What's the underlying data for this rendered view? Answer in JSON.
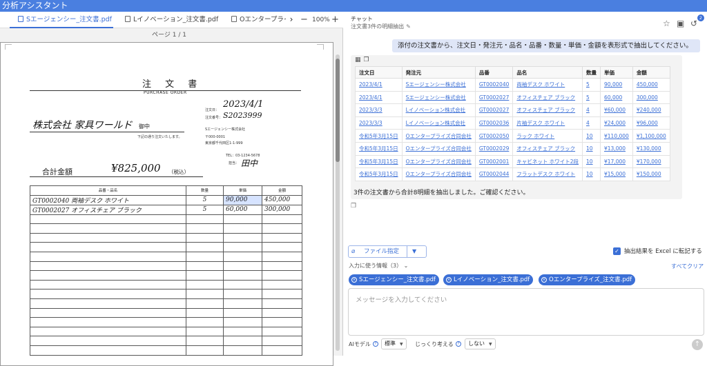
{
  "app": {
    "title": "分析アシスタント"
  },
  "viewer": {
    "tabs": [
      {
        "label": "Sエージェンシー_注文書.pdf"
      },
      {
        "label": "Lイノベーション_注文書.pdf"
      },
      {
        "label": "Oエンタープライ"
      }
    ],
    "zoom": "100%",
    "page_indicator": "ページ 1 / 1"
  },
  "document": {
    "title": "注 文 書",
    "subtitle": "PURCHASE ORDER",
    "recipient": "株式会社 家具ワールド",
    "honorific": "御中",
    "recipient_note": "下記の通り注文いたします。",
    "order_date_label": "注文日：",
    "order_date": "2023/4/1",
    "order_no_label": "注文番号：",
    "order_no": "S2023999",
    "issuer_name": "Sエージェンシー株式会社",
    "issuer_zip": "〒000-0001",
    "issuer_address": "東京都千代田区1-1-999",
    "issuer_tel": "TEL：03-1234-5678",
    "contact_label": "担当：",
    "contact": "田中",
    "total_label": "合計金額",
    "total_value": "¥825,000",
    "total_tax": "（税込）",
    "table_headers": [
      "品番・品名",
      "数量",
      "単価",
      "金額"
    ],
    "rows": [
      {
        "item": "GT0002040 両袖デスク ホワイト",
        "qty": "5",
        "price": "90,000",
        "amount": "450,000"
      },
      {
        "item": "GT0002027 オフィスチェア ブラック",
        "qty": "5",
        "price": "60,000",
        "amount": "300,000"
      }
    ]
  },
  "chat": {
    "title": "チャット",
    "subtitle": "注文書3件の明細抽出",
    "notification_count": "2",
    "user_message": "添付の注文書から、注文日・発注元・品名・品番・数量・単価・金額を表形式で抽出してください。",
    "result_headers": [
      "注文日",
      "発注元",
      "品番",
      "品名",
      "数量",
      "単価",
      "金額"
    ],
    "result_rows": [
      [
        "2023/4/1",
        "Sエージェンシー株式会社",
        "GT0002040",
        "両袖デスク ホワイト",
        "5",
        "90,000",
        "450,000"
      ],
      [
        "2023/4/1",
        "Sエージェンシー株式会社",
        "GT0002027",
        "オフィスチェア ブラック",
        "5",
        "60,000",
        "300,000"
      ],
      [
        "2023/3/3",
        "Lイノベーション株式会社",
        "GT0002027",
        "オフィスチェア ブラック",
        "4",
        "¥60,000",
        "¥240,000"
      ],
      [
        "2023/3/3",
        "Lイノベーション株式会社",
        "GT0002036",
        "片袖デスク ホワイト",
        "4",
        "¥24,000",
        "¥96,000"
      ],
      [
        "令和5年3月15日",
        "Oエンタープライズ合同会社",
        "GT0002050",
        "ラック ホワイト",
        "10",
        "¥110,000",
        "¥1,100,000"
      ],
      [
        "令和5年3月15日",
        "Oエンタープライズ合同会社",
        "GT0002029",
        "オフィスチェア ブラック",
        "10",
        "¥13,000",
        "¥130,000"
      ],
      [
        "令和5年3月15日",
        "Oエンタープライズ合同会社",
        "GT0002001",
        "キャビネット ホワイト2段",
        "10",
        "¥17,000",
        "¥170,000"
      ],
      [
        "令和5年3月15日",
        "Oエンタープライズ合同会社",
        "GT0002044",
        "フラットデスク ホワイト",
        "10",
        "¥15,000",
        "¥150,000"
      ]
    ],
    "assistant_summary": "3件の注文書から合計8明細を抽出しました。ご確認ください。",
    "file_button": "ファイル指定",
    "excel_checkbox": "抽出結果を Excel に転記する",
    "excel_checked": true,
    "input_info_label": "入力に使う情報（3）",
    "clear_all": "すべてクリア",
    "chips": [
      "Sエージェンシー_注文書.pdf",
      "Lイノベーション_注文書.pdf",
      "Oエンタープライズ_注文書.pdf"
    ],
    "message_placeholder": "メッセージを入力してください",
    "ai_model_label": "AIモデル",
    "ai_model_value": "標準",
    "think_label": "じっくり考える",
    "think_value": "しない"
  },
  "colors": {
    "accent": "#3b6fd6",
    "app_bar": "#4a7fe0",
    "user_bubble": "#dfe6f7"
  }
}
